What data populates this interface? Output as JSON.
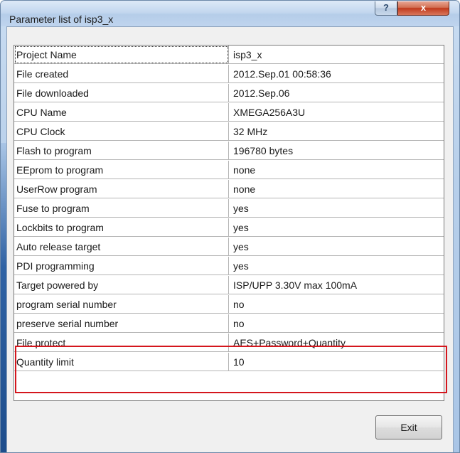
{
  "window": {
    "title": "Parameter list of isp3_x",
    "help_label": "?",
    "close_label": "x"
  },
  "rows": [
    {
      "name": "Project Name",
      "value": "isp3_x"
    },
    {
      "name": "File created",
      "value": "2012.Sep.01 00:58:36"
    },
    {
      "name": "File downloaded",
      "value": "2012.Sep.06"
    },
    {
      "name": "CPU Name",
      "value": "XMEGA256A3U"
    },
    {
      "name": "CPU Clock",
      "value": "32 MHz"
    },
    {
      "name": "Flash to program",
      "value": "196780 bytes"
    },
    {
      "name": "EEprom to program",
      "value": "none"
    },
    {
      "name": "UserRow program",
      "value": "none"
    },
    {
      "name": "Fuse to program",
      "value": "yes"
    },
    {
      "name": "Lockbits to program",
      "value": "yes"
    },
    {
      "name": "Auto release target",
      "value": "yes"
    },
    {
      "name": "PDI programming",
      "value": "yes"
    },
    {
      "name": "Target powered by",
      "value": "ISP/UPP 3.30V  max 100mA"
    },
    {
      "name": "program serial number",
      "value": "no"
    },
    {
      "name": "preserve serial number",
      "value": "no"
    },
    {
      "name": "File protect",
      "value": "AES+Password+Quantity"
    },
    {
      "name": "Quantity limit",
      "value": "10"
    }
  ],
  "buttons": {
    "exit_label": "Exit"
  },
  "colors": {
    "highlight_border": "#d4161d",
    "close_button": "#c0391c",
    "titlebar": "#c3d7ef"
  }
}
